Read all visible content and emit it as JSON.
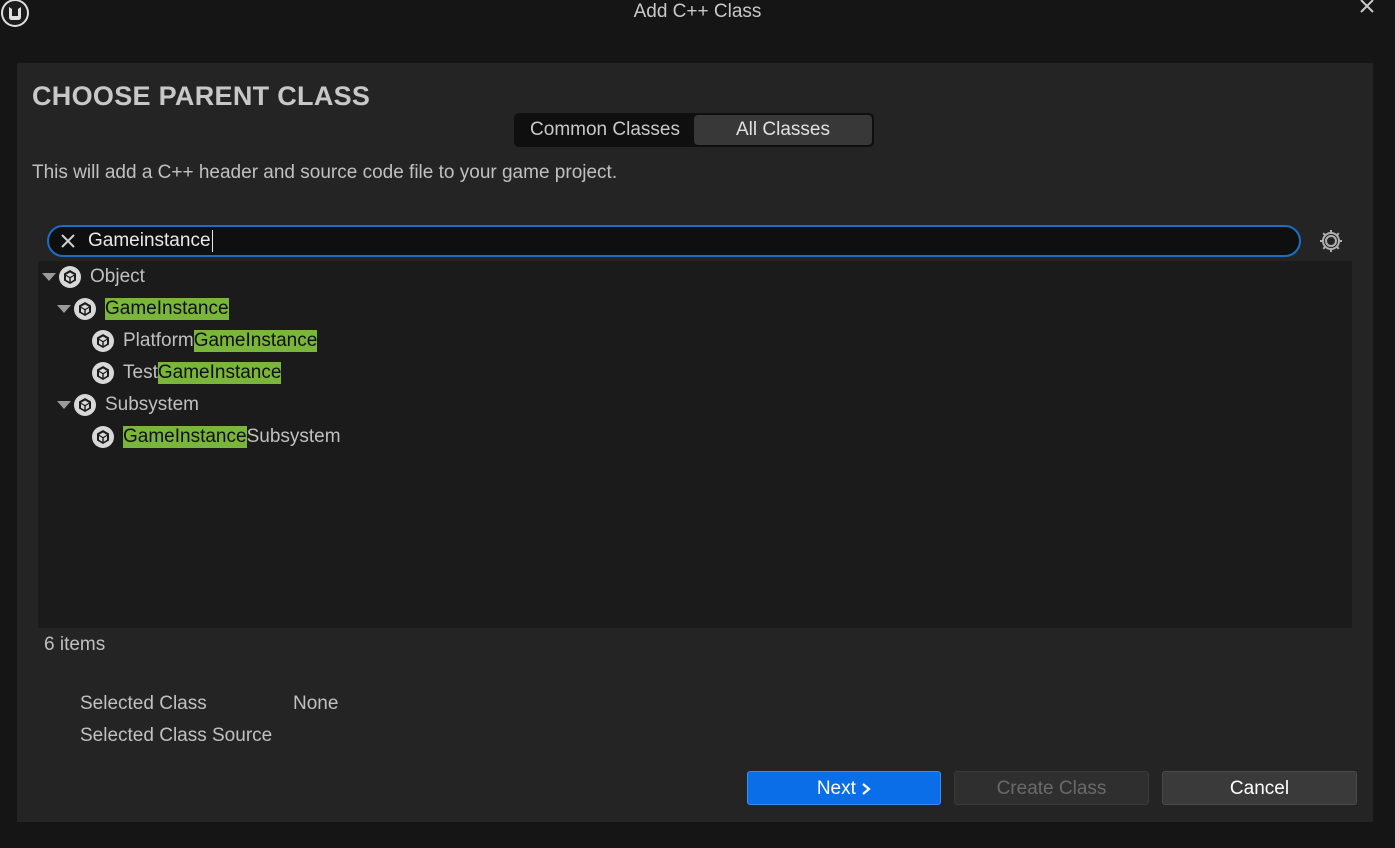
{
  "window": {
    "title": "Add C++ Class"
  },
  "header": {
    "heading": "CHOOSE PARENT CLASS",
    "tabs": [
      {
        "label": "Common Classes",
        "active": false
      },
      {
        "label": "All Classes",
        "active": true
      }
    ],
    "description": "This will add a C++ header and source code file to your game project."
  },
  "search": {
    "value": "Gameinstance"
  },
  "tree": {
    "rows": [
      {
        "pre": "",
        "match": "",
        "post": "Object",
        "depth": 0,
        "expandable": true
      },
      {
        "pre": "",
        "match": "GameInstance",
        "post": "",
        "depth": 1,
        "expandable": true
      },
      {
        "pre": "Platform",
        "match": "GameInstance",
        "post": "",
        "depth": 2,
        "expandable": false
      },
      {
        "pre": "Test",
        "match": "GameInstance",
        "post": "",
        "depth": 2,
        "expandable": false
      },
      {
        "pre": "",
        "match": "",
        "post": "Subsystem",
        "depth": 1,
        "expandable": true
      },
      {
        "pre": "",
        "match": "GameInstance",
        "post": "Subsystem",
        "depth": 2,
        "expandable": false
      }
    ],
    "highlight_color": "#7ab639"
  },
  "status": {
    "items_count": "6 items"
  },
  "selection": {
    "selected_class_label": "Selected Class",
    "selected_class_value": "None",
    "selected_source_label": "Selected Class Source"
  },
  "buttons": {
    "next": "Next",
    "create": "Create Class",
    "cancel": "Cancel"
  },
  "colors": {
    "accent": "#0a6ee8",
    "search_border": "#1a6fc4"
  }
}
